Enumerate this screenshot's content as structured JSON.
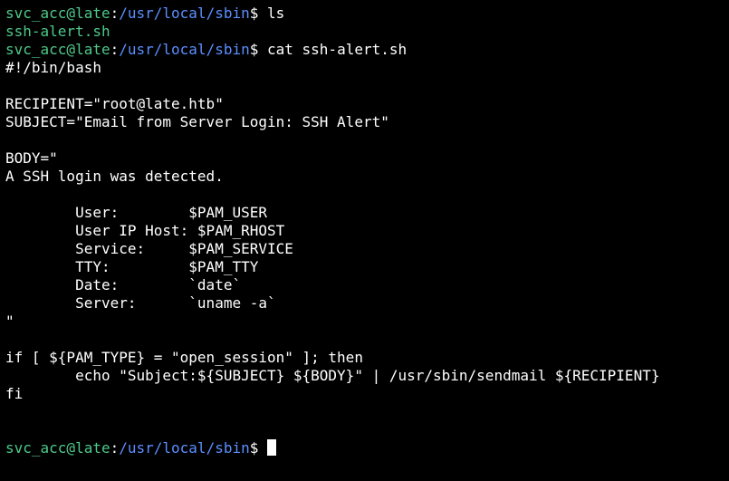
{
  "prompt": {
    "user_host": "svc_acc@late",
    "sep": ":",
    "path": "/usr/local/sbin",
    "suffix": "$ "
  },
  "colors": {
    "background": "#000000",
    "prompt_user": "#4ec98a",
    "prompt_path": "#5b8fff",
    "text": "#ffffff"
  },
  "commands": {
    "first": "ls",
    "second": "cat ssh-alert.sh"
  },
  "ls_output": "ssh-alert.sh",
  "script_lines": [
    "#!/bin/bash",
    "",
    "RECIPIENT=\"root@late.htb\"",
    "SUBJECT=\"Email from Server Login: SSH Alert\"",
    "",
    "BODY=\"",
    "A SSH login was detected.",
    "",
    "        User:        $PAM_USER",
    "        User IP Host: $PAM_RHOST",
    "        Service:     $PAM_SERVICE",
    "        TTY:         $PAM_TTY",
    "        Date:        `date`",
    "        Server:      `uname -a`",
    "\"",
    "",
    "if [ ${PAM_TYPE} = \"open_session\" ]; then",
    "        echo \"Subject:${SUBJECT} ${BODY}\" | /usr/sbin/sendmail ${RECIPIENT}",
    "fi",
    "",
    ""
  ]
}
